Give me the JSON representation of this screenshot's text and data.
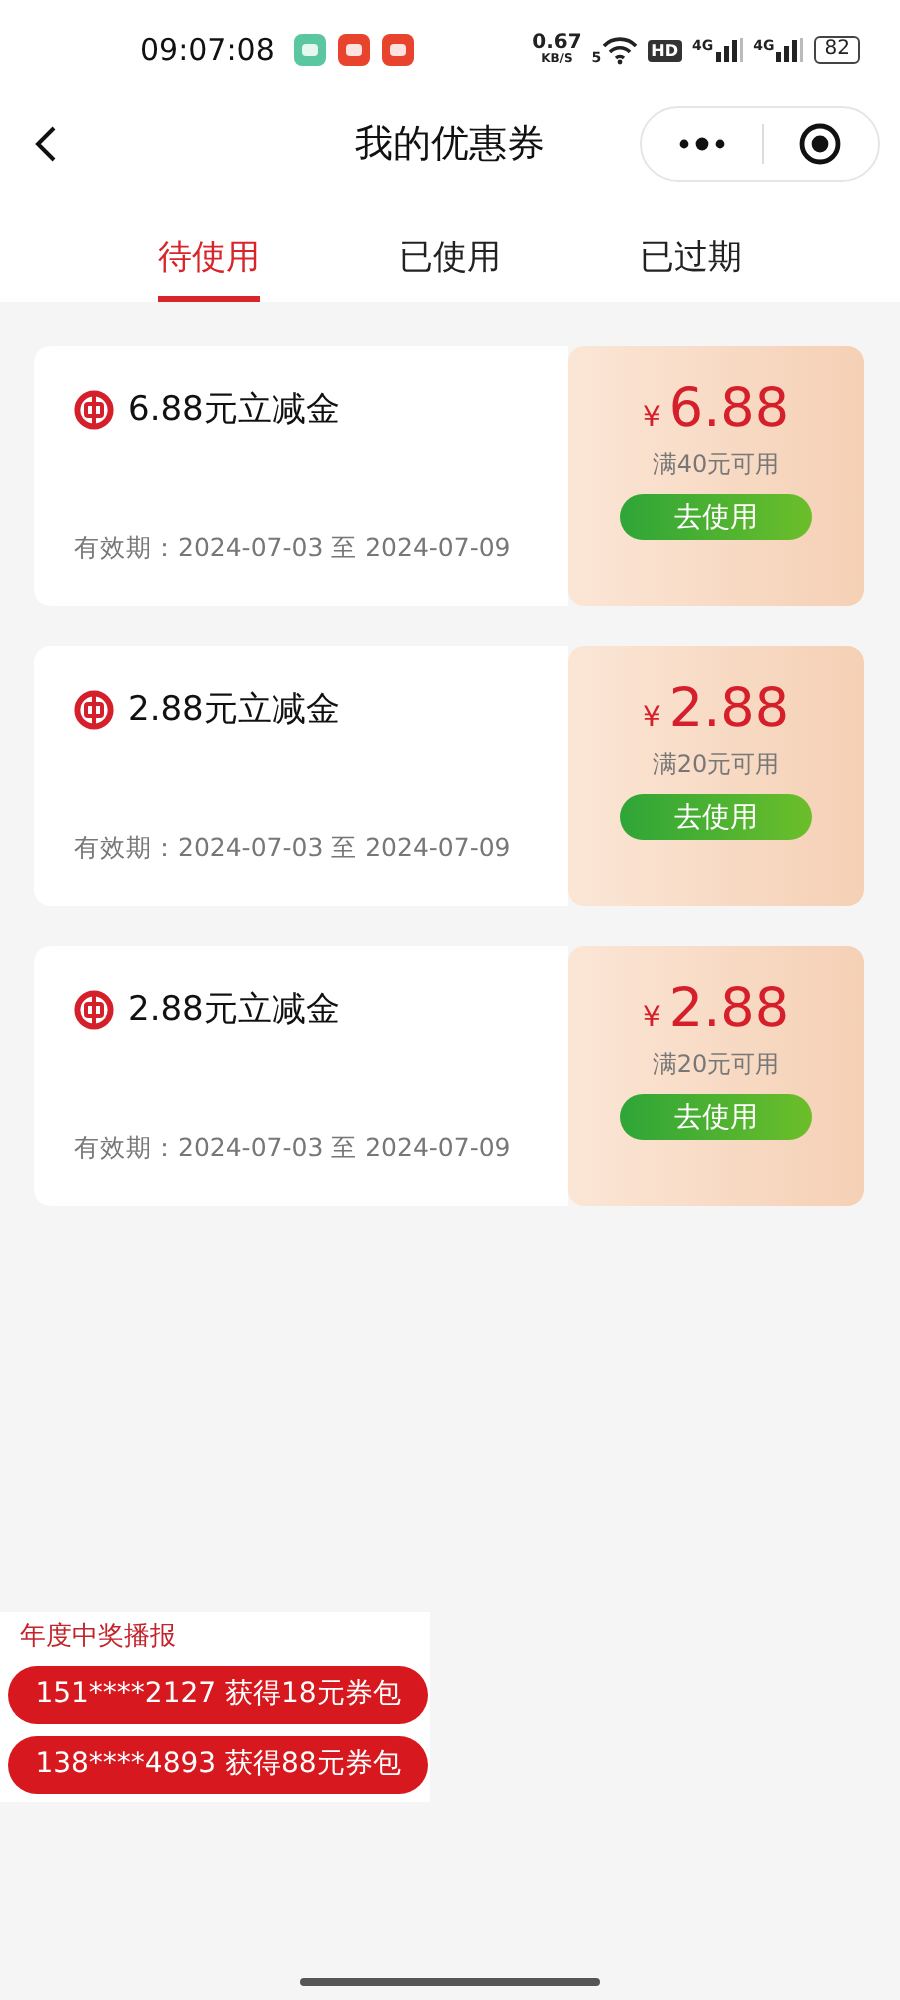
{
  "status_bar": {
    "time": "09:07:08",
    "net_speed": "0.67",
    "net_unit": "KB/S",
    "wifi_label": "5",
    "hd": "HD",
    "sim_labels": [
      "4G",
      "4G"
    ],
    "battery": "82"
  },
  "header": {
    "title": "我的优惠券"
  },
  "tabs": [
    {
      "label": "待使用",
      "selected": true
    },
    {
      "label": "已使用",
      "selected": false
    },
    {
      "label": "已过期",
      "selected": false
    }
  ],
  "coupons": [
    {
      "title": "6.88元立减金",
      "validity": "有效期：2024-07-03 至 2024-07-09",
      "currency": "¥",
      "amount": "6.88",
      "condition": "满40元可用",
      "button": "去使用"
    },
    {
      "title": "2.88元立减金",
      "validity": "有效期：2024-07-03 至 2024-07-09",
      "currency": "¥",
      "amount": "2.88",
      "condition": "满20元可用",
      "button": "去使用"
    },
    {
      "title": "2.88元立减金",
      "validity": "有效期：2024-07-03 至 2024-07-09",
      "currency": "¥",
      "amount": "2.88",
      "condition": "满20元可用",
      "button": "去使用"
    }
  ],
  "ticker": {
    "title": "年度中奖播报",
    "items": [
      "151****2127 获得18元券包",
      "138****4893 获得88元券包"
    ]
  }
}
